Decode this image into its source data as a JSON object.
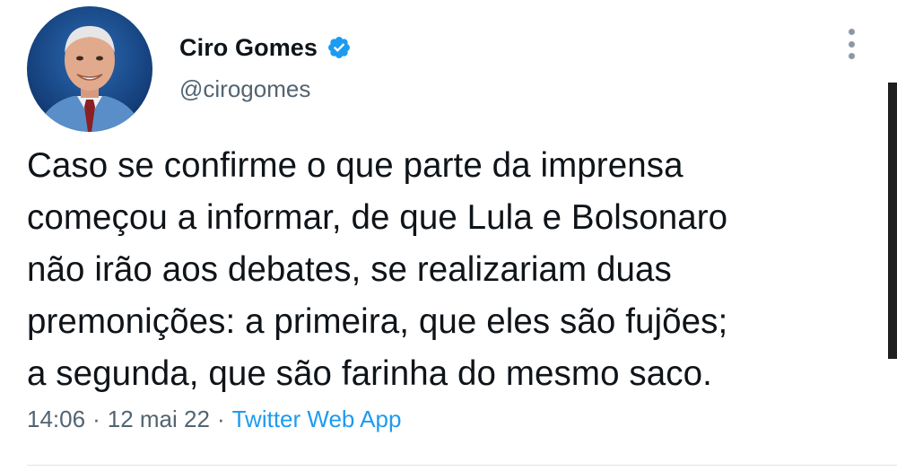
{
  "tweet": {
    "display_name": "Ciro Gomes",
    "handle": "@cirogomes",
    "verified_icon": "verified-badge-icon",
    "more_icon": "more-vertical-icon",
    "text_lines": [
      "Caso se confirme o que parte da imprensa",
      "começou a informar, de que Lula e Bolsonaro",
      "não irão aos debates, se realizariam duas",
      "premonições: a primeira, que eles são fujões;",
      "a segunda, que são farinha do mesmo saco."
    ],
    "time": "14:06",
    "date": "12 mai 22",
    "separator": "·",
    "source": "Twitter Web App"
  },
  "colors": {
    "text": "#0f1419",
    "secondary": "#536471",
    "accent": "#1d9bf0"
  }
}
